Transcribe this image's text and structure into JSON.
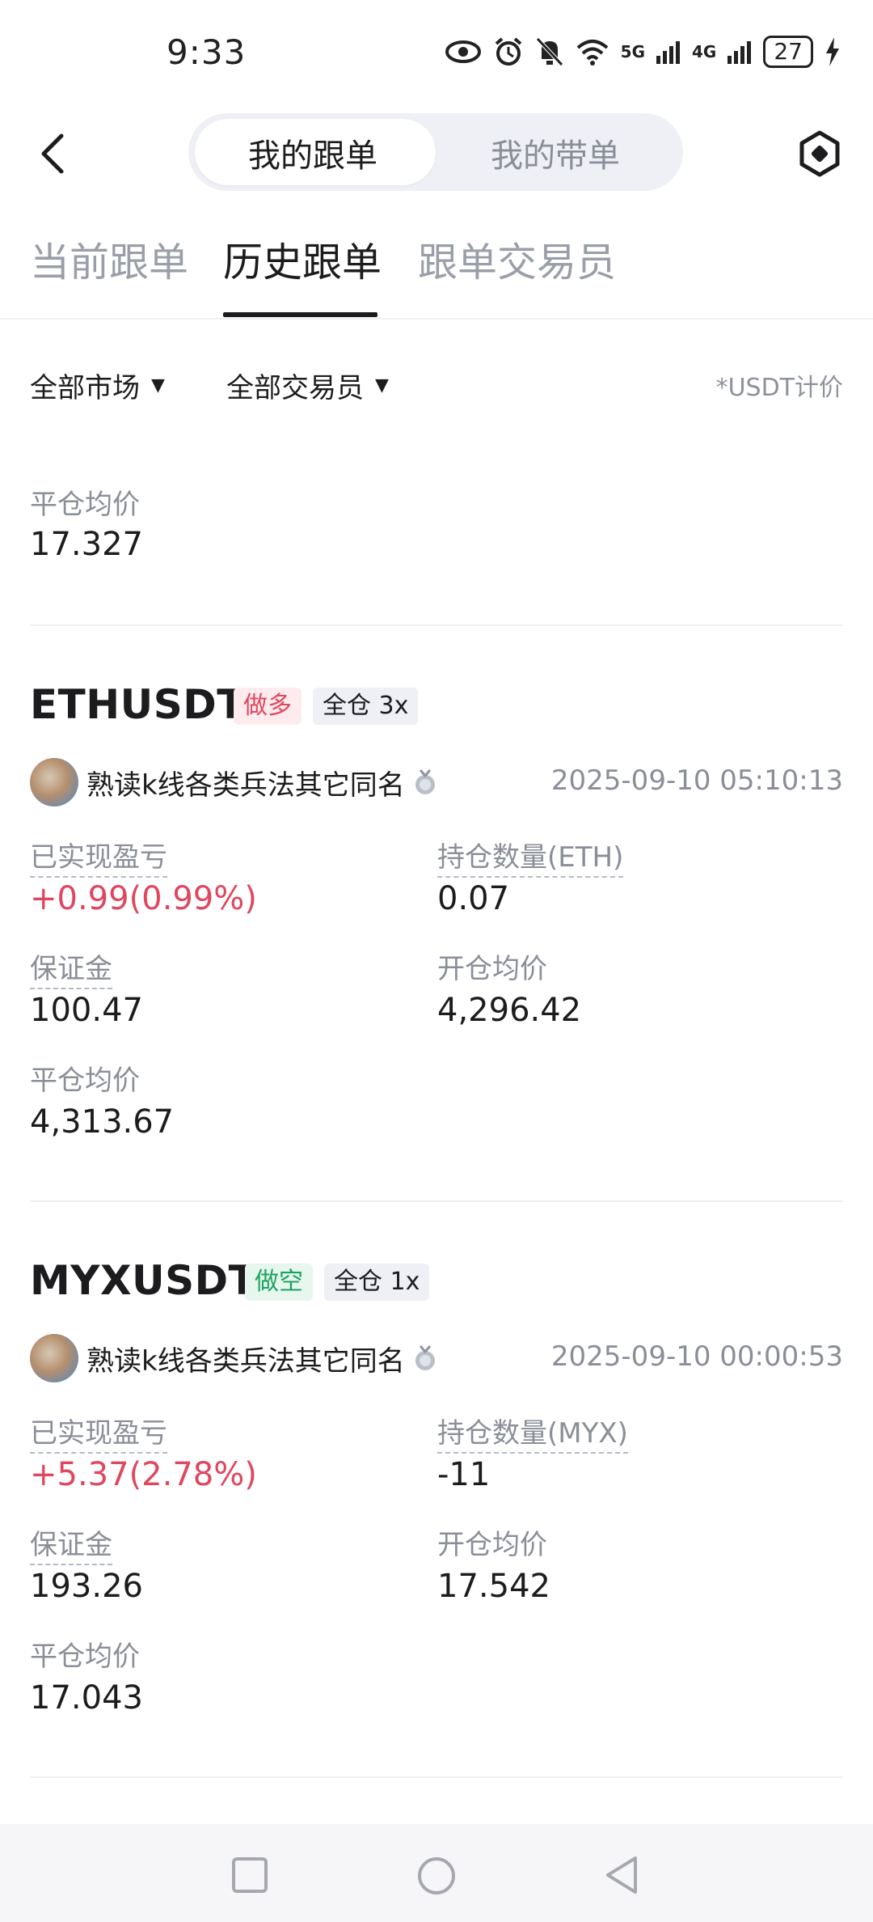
{
  "status_bar": {
    "time": "9:33",
    "signal_5g": "5G",
    "signal_4g": "4G",
    "battery": "27"
  },
  "header": {
    "segments": [
      "我的跟单",
      "我的带单"
    ],
    "active_segment": 0
  },
  "tabs": [
    "当前跟单",
    "历史跟单",
    "跟单交易员"
  ],
  "active_tab": 1,
  "filters": {
    "market": "全部市场",
    "trader": "全部交易员",
    "note": "*USDT计价"
  },
  "partial_card": {
    "close_price_label": "平仓均价",
    "close_price": "17.327"
  },
  "orders": [
    {
      "symbol": "ETHUSDT",
      "side": "做多",
      "margin_mode": "全仓 3x",
      "trader": "熟读k线各类兵法其它同名",
      "time": "2025-09-10 05:10:13",
      "pnl_label": "已实现盈亏",
      "pnl": "+0.99(0.99%)",
      "qty_label": "持仓数量(ETH)",
      "qty": "0.07",
      "margin_label": "保证金",
      "margin": "100.47",
      "open_label": "开仓均价",
      "open_price": "4,296.42",
      "close_label": "平仓均价",
      "close_price": "4,313.67"
    },
    {
      "symbol": "MYXUSDT",
      "side": "做空",
      "margin_mode": "全仓 1x",
      "trader": "熟读k线各类兵法其它同名",
      "time": "2025-09-10 00:00:53",
      "pnl_label": "已实现盈亏",
      "pnl": "+5.37(2.78%)",
      "qty_label": "持仓数量(MYX)",
      "qty": "-11",
      "margin_label": "保证金",
      "margin": "193.26",
      "open_label": "开仓均价",
      "open_price": "17.542",
      "close_label": "平仓均价",
      "close_price": "17.043"
    }
  ],
  "colors": {
    "profit": "#e0475f",
    "long_tag": "#e0475f",
    "short_tag": "#1ba361"
  },
  "icons": {
    "back": "chevron-left-icon",
    "settings": "hexagon-settings-icon",
    "medal": "medal-icon",
    "nav_recents": "square-icon",
    "nav_home": "circle-icon",
    "nav_back": "triangle-back-icon"
  }
}
